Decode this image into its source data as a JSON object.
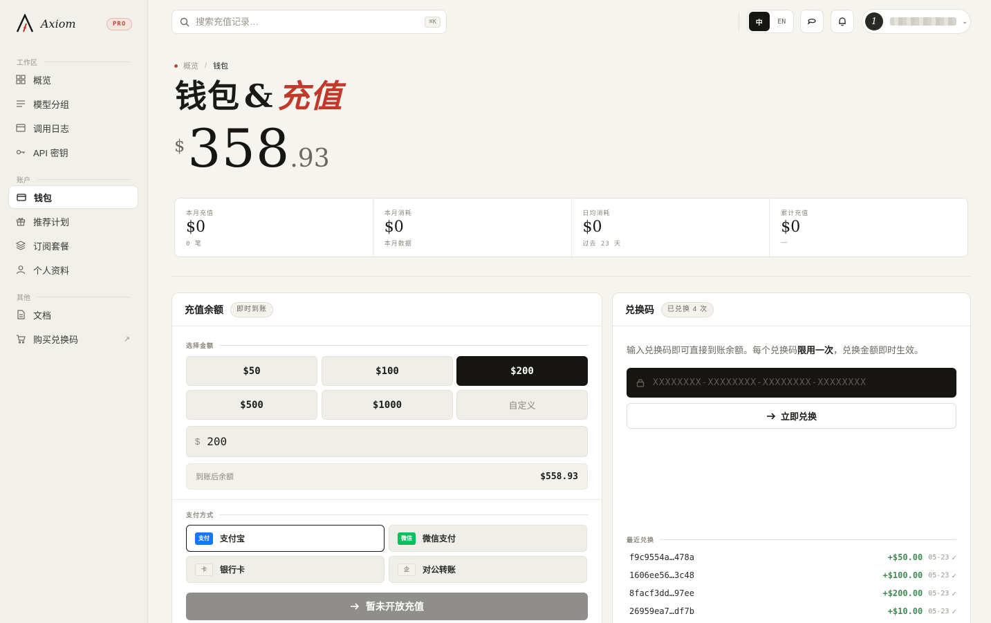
{
  "brand": {
    "name": "Axiom",
    "badge": "PRO"
  },
  "sidebar": {
    "sections": [
      {
        "label": "工作区"
      },
      {
        "label": "账户"
      },
      {
        "label": "其他"
      }
    ],
    "items": [
      {
        "label": "概览",
        "icon": "grid-icon"
      },
      {
        "label": "模型分组",
        "icon": "list-icon"
      },
      {
        "label": "调用日志",
        "icon": "log-icon"
      },
      {
        "label": "API 密钥",
        "icon": "key-icon"
      },
      {
        "label": "钱包",
        "icon": "wallet-icon",
        "active": true
      },
      {
        "label": "推荐计划",
        "icon": "gift-icon"
      },
      {
        "label": "订阅套餐",
        "icon": "layers-icon"
      },
      {
        "label": "个人资料",
        "icon": "user-icon"
      },
      {
        "label": "文档",
        "icon": "document-icon"
      },
      {
        "label": "购买兑换码",
        "icon": "cart-icon",
        "external": "↗"
      }
    ]
  },
  "topbar": {
    "search_placeholder": "搜索充值记录…",
    "shortcut": "⌘K",
    "lang_zh": "中",
    "lang_en": "EN",
    "avatar_initial": "1",
    "chevron": "⌄"
  },
  "breadcrumb": {
    "parent": "概览",
    "separator": "/",
    "current": "钱包"
  },
  "title": {
    "main": "钱包",
    "amp": "&",
    "accent": "充值"
  },
  "balance": {
    "currency": "$",
    "integer": "358",
    "decimal": ".93"
  },
  "stats": [
    {
      "label": "本月充值",
      "value": "$0",
      "sub": "0 笔"
    },
    {
      "label": "本月消耗",
      "value": "$0",
      "sub": "本月数据"
    },
    {
      "label": "日均消耗",
      "value": "$0",
      "sub": "过去 23 天"
    },
    {
      "label": "累计充值",
      "value": "$0",
      "sub": "—"
    }
  ],
  "recharge": {
    "title": "充值余额",
    "tag": "即时到账",
    "amount_label": "选择金额",
    "amounts": [
      "$50",
      "$100",
      "$200",
      "$500",
      "$1000",
      "自定义"
    ],
    "selected": "$200",
    "currency_symbol": "$",
    "input_value": "200",
    "after_label": "到账后余额",
    "after_value": "$558.93",
    "pay_label": "支付方式",
    "pay_methods": [
      {
        "label": "支付宝",
        "icon_text": "支付",
        "color": "#1677ff",
        "selected": true
      },
      {
        "label": "微信支付",
        "icon_text": "微信",
        "color": "#07c160"
      },
      {
        "label": "银行卡",
        "icon_text": "卡"
      },
      {
        "label": "对公转账",
        "icon_text": "企"
      }
    ],
    "submit_label": "暂未开放充值"
  },
  "redeem": {
    "title": "兑换码",
    "tag": "已兑换 4 次",
    "desc_before": "输入兑换码即可直接到账余额。每个兑换码",
    "desc_bold": "限用一次",
    "desc_after": "，兑换金额即时生效。",
    "input_placeholder": "XXXXXXXX-XXXXXXXX-XXXXXXXX-XXXXXXXX",
    "button_label": "立即兑换",
    "recent_label": "最近兑换",
    "recent": [
      {
        "code": "f9c9554a…478a",
        "amount": "+$50.00",
        "date": "05-23",
        "status": "✓"
      },
      {
        "code": "1606ee56…3c48",
        "amount": "+$100.00",
        "date": "05-23",
        "status": "✓"
      },
      {
        "code": "8facf3dd…97ee",
        "amount": "+$200.00",
        "date": "05-23",
        "status": "✓"
      },
      {
        "code": "26959ea7…df7b",
        "amount": "+$10.00",
        "date": "05-23",
        "status": "✓"
      }
    ]
  },
  "colors": {
    "accent": "#c0392b",
    "success": "#3f8a55",
    "dark": "#161512"
  }
}
